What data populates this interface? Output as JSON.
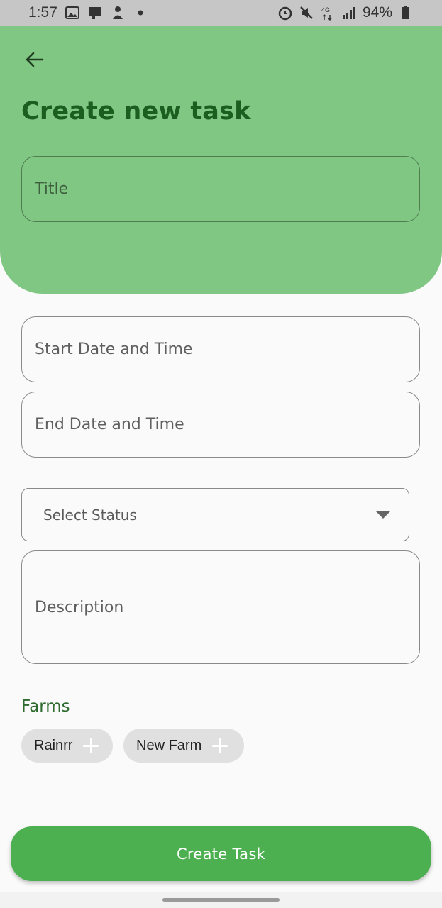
{
  "status_bar": {
    "time": "1:57",
    "battery": "94%",
    "network": "4G"
  },
  "header": {
    "back_icon": "arrow-left-icon",
    "title": "Create new task",
    "title_placeholder": "Title",
    "accent_color": "#81c784",
    "title_color": "#1b5e20"
  },
  "form": {
    "start_placeholder": "Start Date and Time",
    "end_placeholder": "End Date and Time",
    "status_select": "Select Status",
    "description_placeholder": "Description"
  },
  "farms": {
    "label": "Farms",
    "chips": [
      {
        "label": "Rainrr",
        "icon": "plus-icon"
      },
      {
        "label": "New Farm",
        "icon": "plus-icon"
      }
    ]
  },
  "actions": {
    "create_label": "Create Task",
    "button_color": "#4caf50"
  }
}
